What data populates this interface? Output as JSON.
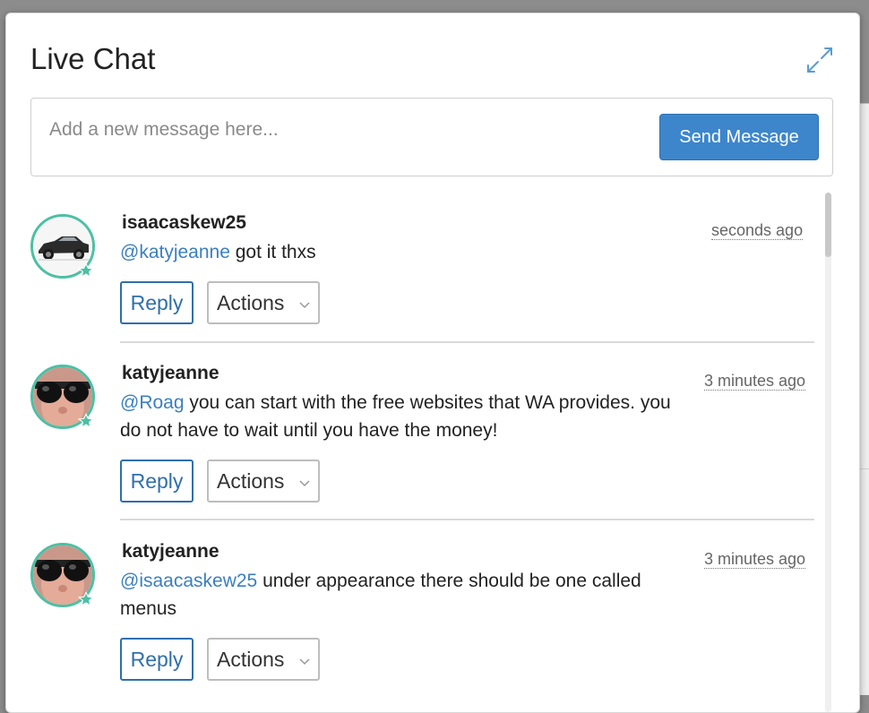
{
  "window": {
    "title": "Live Chat"
  },
  "compose": {
    "placeholder": "Add a new message here...",
    "send_label": "Send Message"
  },
  "colors": {
    "accent": "#3d86cc",
    "mention": "#3a7fc0",
    "avatar_ring": "#4cc0a4"
  },
  "icons": {
    "expand": "expand-arrows-icon",
    "badge": "star-icon",
    "chevron": "chevron-down-icon"
  },
  "messages": [
    {
      "username": "isaacaskew25",
      "time": "seconds ago",
      "mention": "@katyjeanne",
      "text": " got it thxs",
      "reply_label": "Reply",
      "actions_label": "Actions",
      "avatar": "car-avatar"
    },
    {
      "username": "katyjeanne",
      "time": "3 minutes ago",
      "mention": "@Roag",
      "text": " you can start with the free websites that WA provides. you do not have to wait until you have the money!",
      "reply_label": "Reply",
      "actions_label": "Actions",
      "avatar": "sunglasses-avatar"
    },
    {
      "username": "katyjeanne",
      "time": "3 minutes ago",
      "mention": "@isaacaskew25",
      "text": " under appearance there should be one called menus",
      "reply_label": "Reply",
      "actions_label": "Actions",
      "avatar": "sunglasses-avatar"
    }
  ]
}
